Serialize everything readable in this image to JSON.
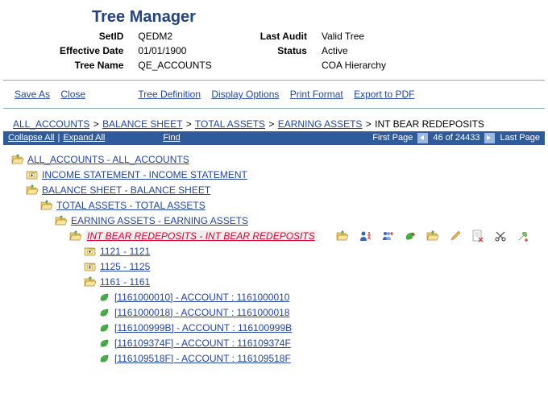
{
  "header": {
    "title": "Tree Manager",
    "labels": {
      "setid": "SetID",
      "effdate": "Effective Date",
      "treename": "Tree Name",
      "lastaudit": "Last Audit",
      "status": "Status"
    },
    "setid": "QEDM2",
    "effdate": "01/01/1900",
    "treename": "QE_ACCOUNTS",
    "lastaudit": "Valid Tree",
    "status": "Active",
    "desc": "COA Hierarchy"
  },
  "toolbar": {
    "saveas": "Save As",
    "close": "Close",
    "treedef": "Tree Definition",
    "display": "Display Options",
    "print": "Print Format",
    "export": "Export to PDF"
  },
  "breadcrumb": {
    "items": [
      "ALL_ACCOUNTS",
      "BALANCE SHEET",
      "TOTAL ASSETS",
      "EARNING ASSETS"
    ],
    "last": "INT BEAR REDEPOSITS"
  },
  "stripe": {
    "collapse": "Collapse All",
    "expand": "Expand All",
    "find": "Find",
    "firstpage": "First Page",
    "pos": "46 of 24433",
    "lastpage": "Last Page"
  },
  "tree": {
    "n0": "ALL_ACCOUNTS - ALL_ACCOUNTS",
    "n1": "INCOME STATEMENT - INCOME STATEMENT",
    "n2": "BALANCE SHEET - BALANCE SHEET",
    "n3": "TOTAL ASSETS - TOTAL ASSETS",
    "n4": "EARNING ASSETS - EARNING ASSETS",
    "n5": "INT BEAR REDEPOSITS - INT BEAR REDEPOSITS",
    "n6": "1121 - 1121",
    "n7": "1125 - 1125",
    "n8": "1161 - 1161",
    "n9": "[1161000010] - ACCOUNT : 1161000010",
    "n10": "[1161000018] - ACCOUNT : 1161000018",
    "n11": "[116100999B] - ACCOUNT : 116100999B",
    "n12": "[116109374F] - ACCOUNT : 116109374F",
    "n13": "[116109518F] - ACCOUNT : 116109518F"
  }
}
